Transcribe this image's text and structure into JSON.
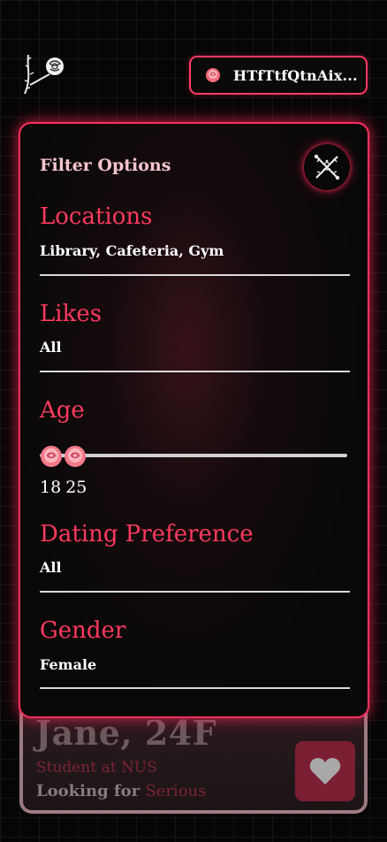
{
  "header": {
    "logo_icon": "rose-with-thorny-stem-icon",
    "wallet": {
      "icon": "rose-icon",
      "address": "HTfTtfQtnAix..."
    }
  },
  "profile": {
    "name": "Jane, 24F",
    "role": "Student at NUS",
    "looking_prefix": "Looking for",
    "looking_value": "Serious",
    "like_icon": "heart-icon"
  },
  "filter": {
    "title": "Filter Options",
    "close_icon": "crossed-thorns-close-icon",
    "sections": {
      "locations": {
        "label": "Locations",
        "value": "Library, Cafeteria, Gym"
      },
      "likes": {
        "label": "Likes",
        "value": "All"
      },
      "age": {
        "label": "Age",
        "min": "18",
        "max": "25",
        "thumb_icon": "rose-icon"
      },
      "dating_preference": {
        "label": "Dating Preference",
        "value": "All"
      },
      "gender": {
        "label": "Gender",
        "value": "Female"
      }
    }
  },
  "colors": {
    "accent": "#ff3a5e",
    "title_pink": "#f5c5cf",
    "background": "#060606",
    "like_button": "#7b1f33"
  }
}
